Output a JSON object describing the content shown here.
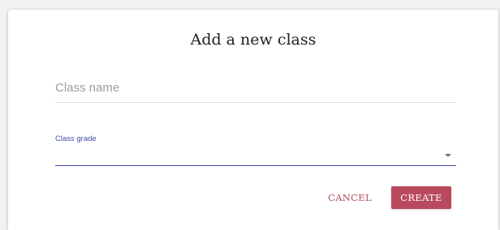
{
  "dialog": {
    "title": "Add a new class",
    "class_name": {
      "placeholder": "Class name",
      "value": ""
    },
    "class_grade": {
      "label": "Class grade",
      "selected": ""
    },
    "buttons": {
      "cancel_label": "CANCEL",
      "create_label": "CREATE"
    }
  },
  "colors": {
    "accent": "#3f4ba8",
    "primary_button": "#b94a5e",
    "cancel_text": "#b44a5e"
  },
  "icons": {
    "grade_dropdown": "chevron-down-icon"
  }
}
